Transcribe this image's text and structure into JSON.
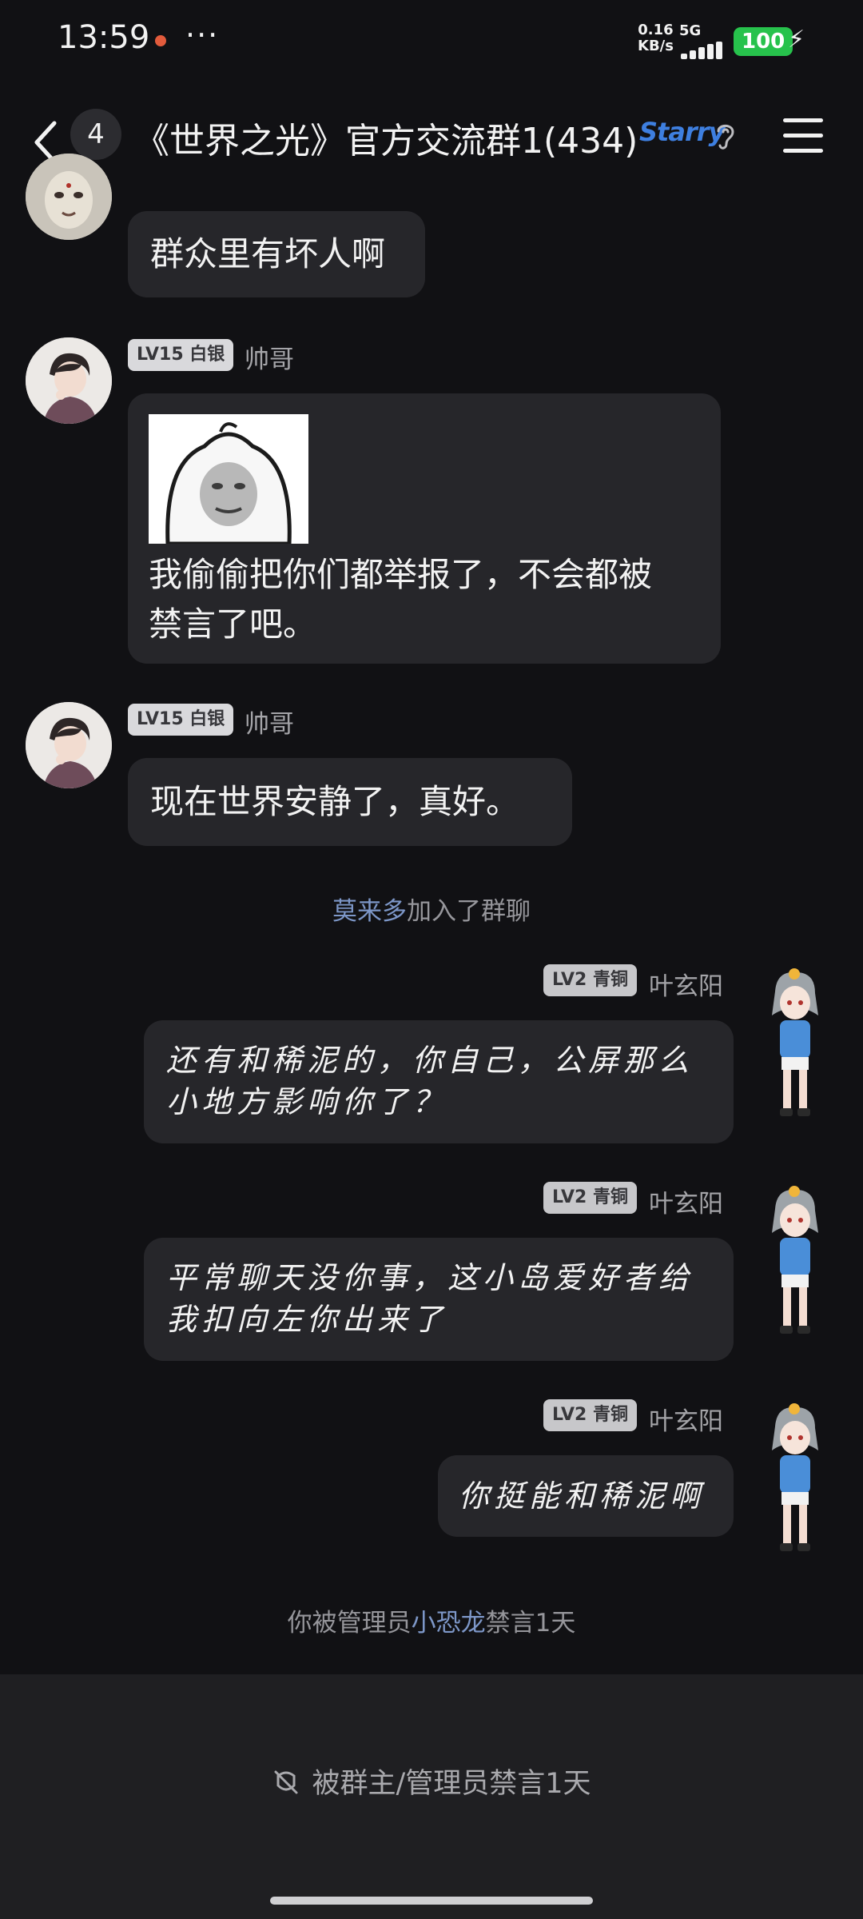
{
  "status_bar": {
    "time": "13:59",
    "more": "···",
    "net_speed_value": "0.16",
    "net_speed_unit": "KB/s",
    "network": "5G",
    "battery": "100",
    "charging_icon": "bolt-icon"
  },
  "header": {
    "unread_count": "4",
    "title": "《世界之光》官方交流群1(434)",
    "tag_label": "Starry",
    "icons": [
      "back-icon",
      "ear-icon",
      "menu-icon"
    ]
  },
  "messages": [
    {
      "side": "left",
      "text": "群众里有坏人啊"
    },
    {
      "side": "left",
      "level": "LV15 白银",
      "sender": "帅哥",
      "image_icon": "meme-sticker",
      "text_line1": "我偷偷把你们都举报了，不会都被",
      "text_line2": "禁言了吧。"
    },
    {
      "side": "left",
      "level": "LV15 白银",
      "sender": "帅哥",
      "text": "现在世界安静了，真好。"
    },
    {
      "side": "right",
      "level": "LV2 青铜",
      "sender": "叶玄阳",
      "text_line1": "还有和稀泥的，你自己，公屏那么",
      "text_line2": "小地方影响你了？"
    },
    {
      "side": "right",
      "level": "LV2 青铜",
      "sender": "叶玄阳",
      "text_line1": "平常聊天没你事，这小岛爱好者给",
      "text_line2": "我扣向左你出来了"
    },
    {
      "side": "right",
      "level": "LV2 青铜",
      "sender": "叶玄阳",
      "text": "你挺能和稀泥啊"
    }
  ],
  "system_notices": {
    "join_name": "莫来多",
    "join_suffix": "加入了群聊",
    "mute_prefix": "你被管理员",
    "mute_admin": "小恐龙",
    "mute_suffix": "禁言1天"
  },
  "bottom_bar": {
    "mute_text": "被群主/管理员禁言1天",
    "mute_icon": "mute-icon"
  },
  "colors": {
    "background": "#111114",
    "bubble": "#26262a",
    "battery": "#27c24c",
    "link": "#7d97c8"
  }
}
